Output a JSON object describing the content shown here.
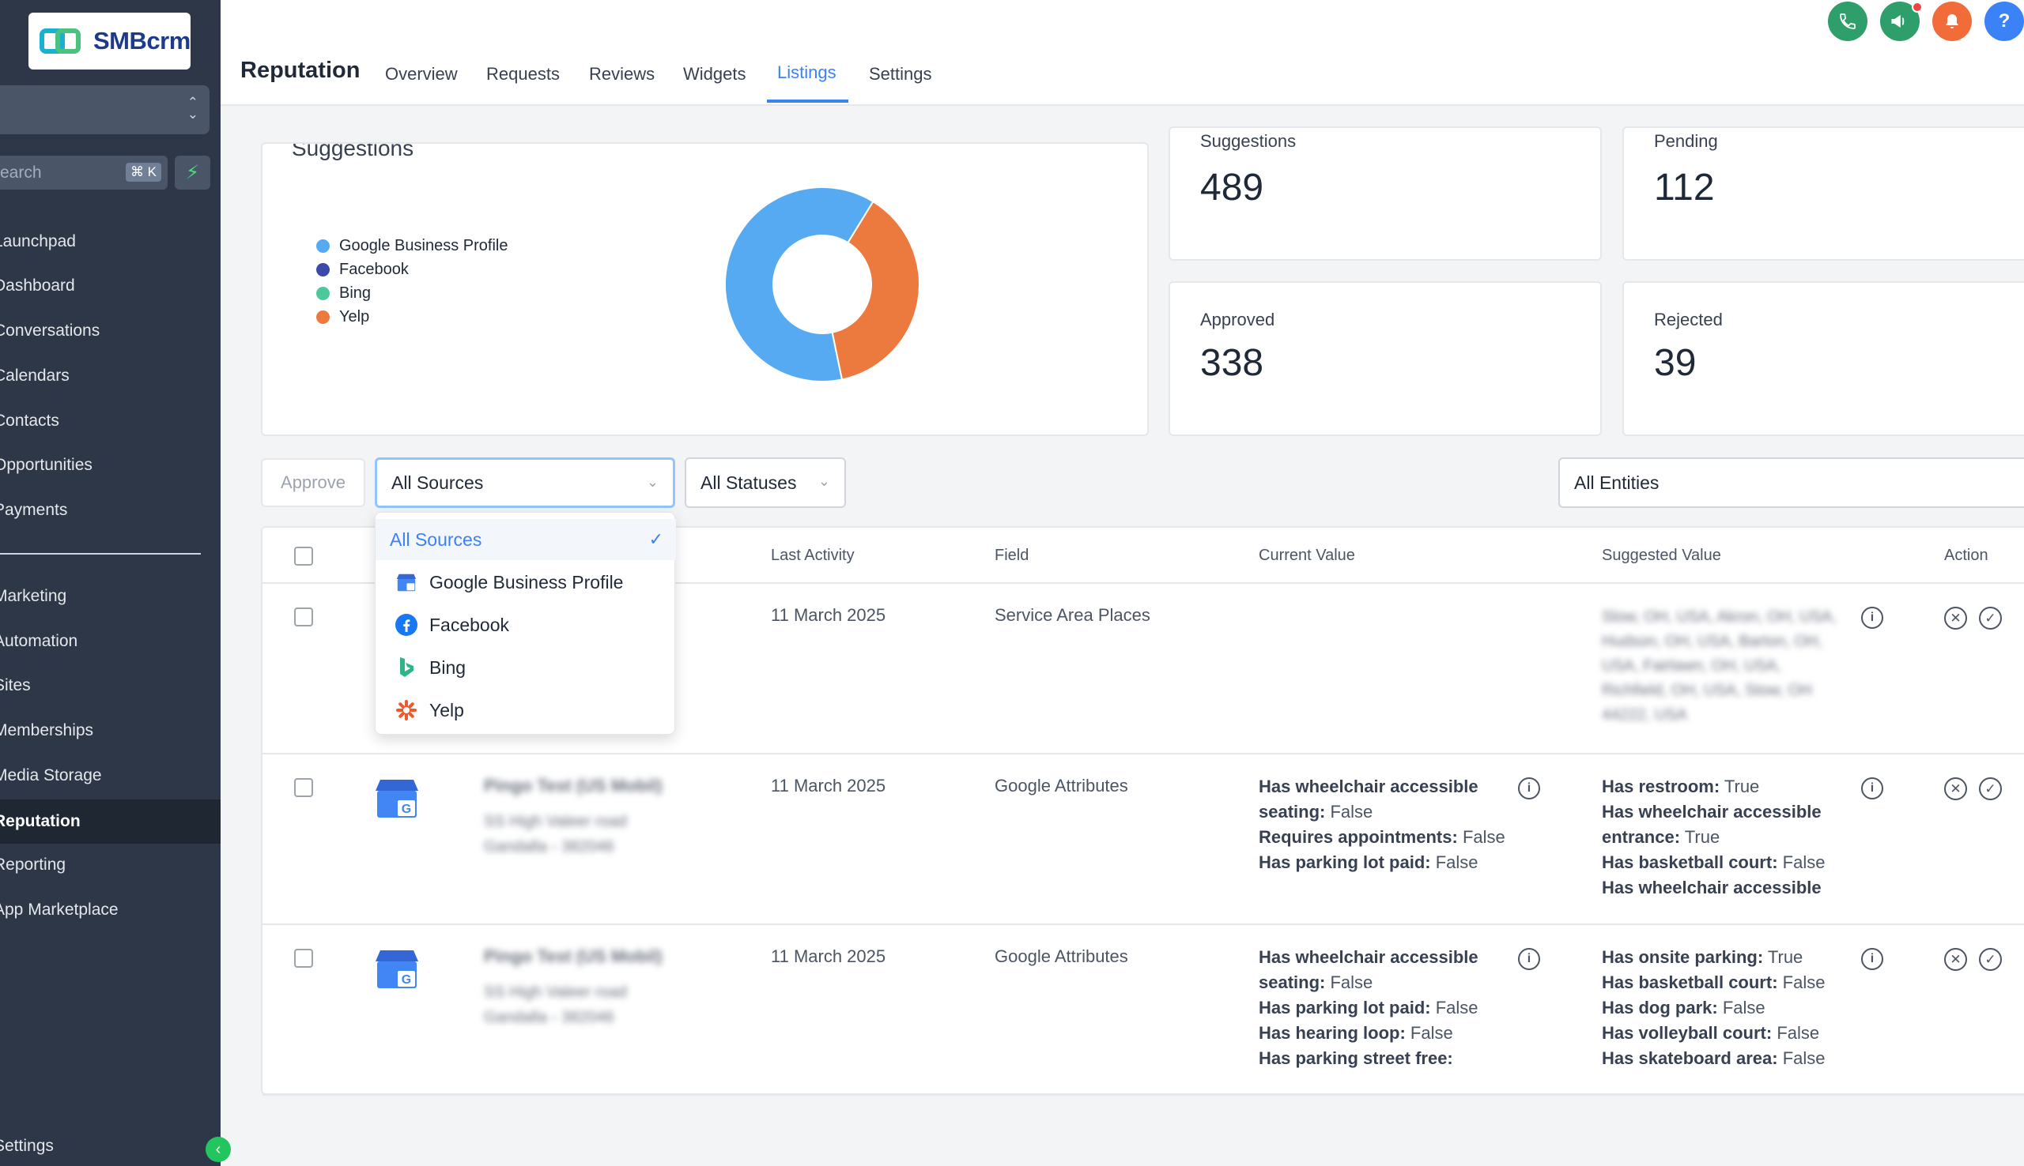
{
  "brand": {
    "name": "SMBcrm"
  },
  "search": {
    "placeholder": "earch",
    "shortcut": "⌘ K"
  },
  "sidebar": {
    "items": [
      {
        "label": "Launchpad"
      },
      {
        "label": "Dashboard"
      },
      {
        "label": "Conversations"
      },
      {
        "label": "Calendars"
      },
      {
        "label": "Contacts"
      },
      {
        "label": "Opportunities"
      },
      {
        "label": "Payments"
      },
      {
        "label": "Marketing"
      },
      {
        "label": "Automation"
      },
      {
        "label": "Sites"
      },
      {
        "label": "Memberships"
      },
      {
        "label": "Media Storage"
      },
      {
        "label": "Reputation",
        "active": true
      },
      {
        "label": "Reporting"
      },
      {
        "label": "App Marketplace"
      }
    ],
    "settings_label": "Settings"
  },
  "header": {
    "title": "Reputation",
    "tabs": [
      {
        "label": "Overview"
      },
      {
        "label": "Requests"
      },
      {
        "label": "Reviews"
      },
      {
        "label": "Widgets"
      },
      {
        "label": "Listings",
        "active": true
      },
      {
        "label": "Settings"
      }
    ],
    "buttons": [
      {
        "icon": "phone-icon",
        "color": "#2e9e6a"
      },
      {
        "icon": "megaphone-icon",
        "color": "#2e9e6a"
      },
      {
        "icon": "bell-icon",
        "color": "#f26c3a"
      },
      {
        "icon": "help-icon",
        "color": "#3b82f6",
        "glyph": "?"
      }
    ]
  },
  "summary": {
    "chart_title": "Suggestions",
    "stats": [
      {
        "label": "Suggestions",
        "value": "489"
      },
      {
        "label": "Pending",
        "value": "112"
      },
      {
        "label": "Approved",
        "value": "338"
      },
      {
        "label": "Rejected",
        "value": "39"
      }
    ]
  },
  "chart_data": {
    "type": "pie",
    "title": "Suggestions",
    "legend": "left",
    "series": [
      {
        "name": "Google Business Profile",
        "color": "#55aaf2",
        "value": 0.62
      },
      {
        "name": "Facebook",
        "color": "#3b4aa8",
        "value": 0
      },
      {
        "name": "Bing",
        "color": "#4cc99a",
        "value": 0
      },
      {
        "name": "Yelp",
        "color": "#ec7a3f",
        "value": 0.38
      }
    ]
  },
  "filters": {
    "approve_label": "Approve",
    "sources": "All Sources",
    "statuses": "All Statuses",
    "entities": "All Entities"
  },
  "dropdown": {
    "items": [
      {
        "label": "All Sources",
        "selected": true
      },
      {
        "label": "Google Business Profile",
        "icon": "gbp-icon"
      },
      {
        "label": "Facebook",
        "icon": "facebook-icon"
      },
      {
        "label": "Bing",
        "icon": "bing-icon"
      },
      {
        "label": "Yelp",
        "icon": "yelp-icon"
      }
    ]
  },
  "table": {
    "headers": {
      "last_activity": "Last Activity",
      "field": "Field",
      "current_value": "Current Value",
      "suggested_value": "Suggested Value",
      "action": "Action"
    },
    "rows": [
      {
        "last_activity": "11 March 2025",
        "field": "Service Area Places",
        "current": [],
        "suggested_redacted": "Slow, OH, USA, Akron, OH, USA, Hudson, OH, USA, Barton, OH, USA, Fairlawn, OH, USA, Richfield, OH, USA, Stow, OH 44222, USA"
      },
      {
        "business_redacted": "Pingo Test (US Mobil)",
        "address_redacted": "SS High Valeer road Gandalla - 382046",
        "last_activity": "11 March 2025",
        "field": "Google Attributes",
        "current": [
          {
            "k": "Has wheelchair accessible seating:",
            "v": "False"
          },
          {
            "k": "Requires appointments:",
            "v": "False"
          },
          {
            "k": "Has parking lot paid:",
            "v": "False"
          }
        ],
        "suggested": [
          {
            "k": "Has restroom:",
            "v": "True"
          },
          {
            "k": "Has wheelchair accessible entrance:",
            "v": "True"
          },
          {
            "k": "Has basketball court:",
            "v": "False"
          },
          {
            "k": "Has wheelchair accessible",
            "v": ""
          }
        ]
      },
      {
        "business_redacted": "Pingo Test (US Mobil)",
        "address_redacted": "SS High Valeer road Gandalla - 382046",
        "last_activity": "11 March 2025",
        "field": "Google Attributes",
        "current": [
          {
            "k": "Has wheelchair accessible seating:",
            "v": "False"
          },
          {
            "k": "Has parking lot paid:",
            "v": "False"
          },
          {
            "k": "Has hearing loop:",
            "v": "False"
          },
          {
            "k": "Has parking street free:",
            "v": ""
          }
        ],
        "suggested": [
          {
            "k": "Has onsite parking:",
            "v": "True"
          },
          {
            "k": "Has basketball court:",
            "v": "False"
          },
          {
            "k": "Has dog park:",
            "v": "False"
          },
          {
            "k": "Has volleyball court:",
            "v": "False"
          },
          {
            "k": "Has skateboard area:",
            "v": "False"
          }
        ]
      }
    ]
  }
}
